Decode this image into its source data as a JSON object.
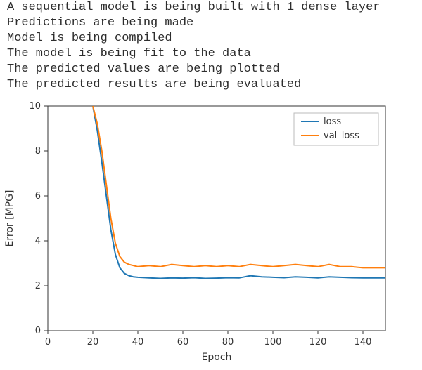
{
  "console_lines": [
    "A sequential model is being built with 1 dense layer",
    "Predictions are being made",
    "Model is being compiled",
    "The model is being fit to the data",
    "The predicted values are being plotted",
    "The predicted results are being evaluated"
  ],
  "chart_data": {
    "type": "line",
    "xlabel": "Epoch",
    "ylabel": "Error [MPG]",
    "xlim": [
      0,
      150
    ],
    "ylim": [
      0,
      10
    ],
    "xticks": [
      0,
      20,
      40,
      60,
      80,
      100,
      120,
      140
    ],
    "yticks": [
      0,
      2,
      4,
      6,
      8,
      10
    ],
    "legend_position": "upper right",
    "x": [
      20,
      22,
      24,
      26,
      28,
      30,
      32,
      34,
      36,
      38,
      40,
      45,
      50,
      55,
      60,
      65,
      70,
      75,
      80,
      85,
      90,
      95,
      100,
      105,
      110,
      115,
      120,
      125,
      130,
      135,
      140,
      145,
      150
    ],
    "series": [
      {
        "name": "loss",
        "color": "#1f77b4",
        "values": [
          10,
          8.9,
          7.5,
          6.0,
          4.5,
          3.4,
          2.8,
          2.55,
          2.45,
          2.4,
          2.38,
          2.35,
          2.33,
          2.35,
          2.34,
          2.36,
          2.33,
          2.34,
          2.36,
          2.35,
          2.45,
          2.4,
          2.38,
          2.36,
          2.4,
          2.38,
          2.35,
          2.4,
          2.38,
          2.36,
          2.35,
          2.35,
          2.35
        ]
      },
      {
        "name": "val_loss",
        "color": "#ff7f0e",
        "values": [
          10,
          9.2,
          8.0,
          6.5,
          5.0,
          3.9,
          3.3,
          3.05,
          2.95,
          2.9,
          2.85,
          2.9,
          2.85,
          2.95,
          2.9,
          2.85,
          2.9,
          2.85,
          2.9,
          2.85,
          2.95,
          2.9,
          2.85,
          2.9,
          2.95,
          2.9,
          2.85,
          2.95,
          2.85,
          2.85,
          2.8,
          2.8,
          2.8
        ]
      }
    ]
  }
}
